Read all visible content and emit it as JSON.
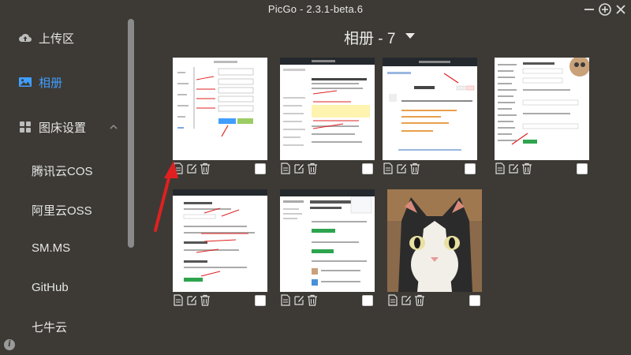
{
  "window": {
    "title": "PicGo - 2.3.1-beta.6",
    "controls": [
      "minimize-icon",
      "maximize-icon",
      "close-icon"
    ]
  },
  "sidebar": {
    "upload": {
      "label": "上传区",
      "icon": "cloud-upload-icon"
    },
    "gallery": {
      "label": "相册",
      "icon": "image-icon",
      "active": true
    },
    "picbed_settings": {
      "label": "图床设置",
      "icon": "grid-icon",
      "expanded": true
    },
    "picbeds": [
      "腾讯云COS",
      "阿里云OSS",
      "SM.MS",
      "GitHub",
      "七牛云"
    ]
  },
  "main": {
    "album_title": "相册 - 7",
    "images": [
      {
        "thumb": "settings-form-screenshot",
        "checked": false
      },
      {
        "thumb": "github-page-screenshot",
        "checked": false
      },
      {
        "thumb": "github-login-screenshot",
        "checked": false
      },
      {
        "thumb": "settings-list-screenshot",
        "checked": false
      },
      {
        "thumb": "github-form-screenshot",
        "checked": false
      },
      {
        "thumb": "github-profile-screenshot",
        "checked": false
      },
      {
        "thumb": "cat-illustration",
        "checked": false
      }
    ]
  },
  "colors": {
    "background": "#3d3a35",
    "accent": "#409eff",
    "annotation_red": "#e02020"
  }
}
